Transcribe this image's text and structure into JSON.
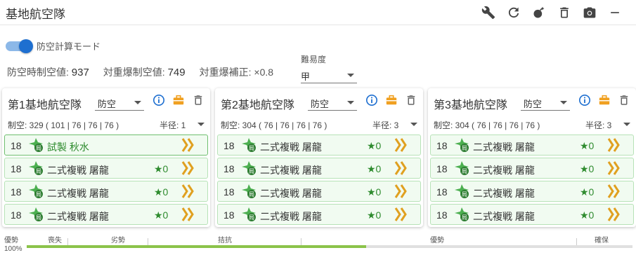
{
  "window": {
    "title": "基地航空隊"
  },
  "toolbar_icons": [
    "wrench-icon",
    "refresh-icon",
    "bomb-icon",
    "trash-icon",
    "camera-icon",
    "minimize-icon"
  ],
  "defense_mode": {
    "label": "防空計算モード",
    "enabled": true
  },
  "stats": {
    "air_defense_label": "防空時制空値:",
    "air_defense_value": "937",
    "bomber_label": "対重爆制空値:",
    "bomber_value": "749",
    "bomber_corr_label": "対重爆補正:",
    "bomber_corr_value": "×0.8"
  },
  "difficulty": {
    "label": "難易度",
    "value": "甲"
  },
  "squadrons": [
    {
      "name": "第1基地航空隊",
      "mode": "防空",
      "summary": "制空: 329 ( 101 | 76 | 76 | 76 )",
      "radius": "半径: 1",
      "planes": [
        {
          "level": "18",
          "name": "試製 秋水",
          "stars": "",
          "green": true
        },
        {
          "level": "18",
          "name": "二式複戦 屠龍",
          "stars": "★0",
          "green": false
        },
        {
          "level": "18",
          "name": "二式複戦 屠龍",
          "stars": "★0",
          "green": false
        },
        {
          "level": "18",
          "name": "二式複戦 屠龍",
          "stars": "★0",
          "green": false
        }
      ]
    },
    {
      "name": "第2基地航空隊",
      "mode": "防空",
      "summary": "制空: 304 ( 76 | 76 | 76 | 76 )",
      "radius": "半径: 3",
      "planes": [
        {
          "level": "18",
          "name": "二式複戦 屠龍",
          "stars": "★0",
          "green": false
        },
        {
          "level": "18",
          "name": "二式複戦 屠龍",
          "stars": "★0",
          "green": false
        },
        {
          "level": "18",
          "name": "二式複戦 屠龍",
          "stars": "★0",
          "green": false
        },
        {
          "level": "18",
          "name": "二式複戦 屠龍",
          "stars": "★0",
          "green": false
        }
      ]
    },
    {
      "name": "第3基地航空隊",
      "mode": "防空",
      "summary": "制空: 304 ( 76 | 76 | 76 | 76 )",
      "radius": "半径: 3",
      "planes": [
        {
          "level": "18",
          "name": "二式複戦 屠龍",
          "stars": "★0",
          "green": false
        },
        {
          "level": "18",
          "name": "二式複戦 屠龍",
          "stars": "★0",
          "green": false
        },
        {
          "level": "18",
          "name": "二式複戦 屠龍",
          "stars": "★0",
          "green": false
        },
        {
          "level": "18",
          "name": "二式複戦 屠龍",
          "stars": "★0",
          "green": false
        }
      ]
    }
  ],
  "air_state": {
    "label_top": "優勢",
    "label_bottom": "100%",
    "zones": [
      "喪失",
      "劣勢",
      "拮抗",
      "優勢",
      "確保"
    ],
    "fill_fraction": 0.56
  },
  "colors": {
    "accent": "#1e6fd0",
    "green": "#2e8b2e",
    "orange": "#f0a020",
    "bar": "#8bc34a"
  }
}
